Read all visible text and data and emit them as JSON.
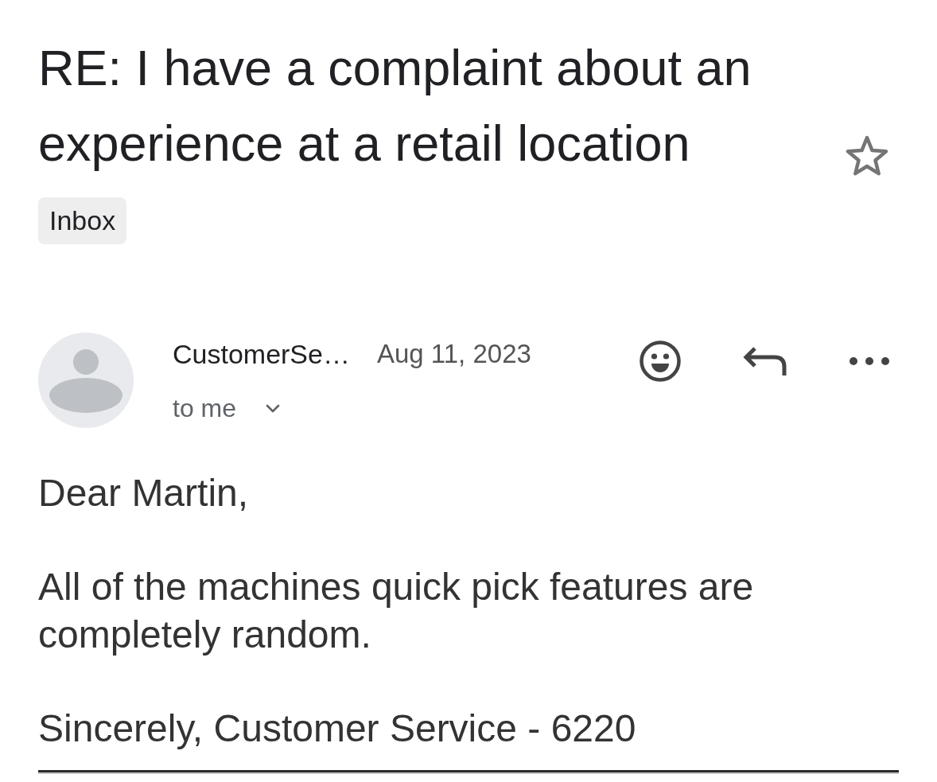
{
  "subject": "RE: I have a complaint about an experience at a retail location",
  "starred": false,
  "labels": [
    "Inbox"
  ],
  "message": {
    "sender": "CustomerSe…",
    "date": "Aug 11, 2023",
    "recipient": "to me",
    "body": [
      "Dear Martin,",
      "All of the machines quick pick features are completely random.",
      "Sincerely, Customer Service - 6220"
    ]
  }
}
